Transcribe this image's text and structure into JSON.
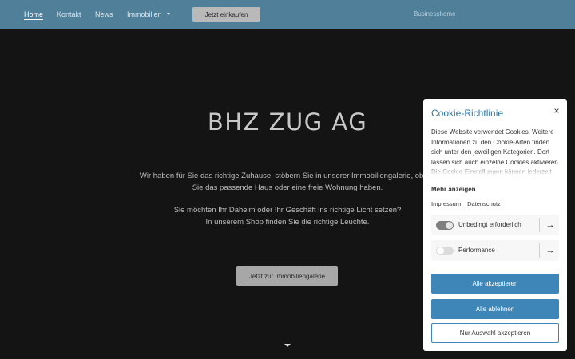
{
  "nav": {
    "items": [
      {
        "label": "Home",
        "active": true
      },
      {
        "label": "Kontakt"
      },
      {
        "label": "News"
      },
      {
        "label": "Immobilien",
        "has_dropdown": true
      }
    ],
    "shop_button": "Jetzt einkaufen",
    "brand": "Businesshome",
    "bg_color": "#4f7f99"
  },
  "hero": {
    "title": "BHZ  ZUG AG",
    "paragraph1_line1": "Wir haben für Sie das richtige Zuhause, stöbern Sie in unserer Immobiliengalerie, ob wir",
    "paragraph1_line2": "Sie das passende Haus oder eine freie Wohnung haben.",
    "paragraph2_line1": "Sie möchten Ihr Daheim oder Ihr Geschäft ins richtige Licht setzen?",
    "paragraph2_line2": "In unserem Shop finden Sie die richtige Leuchte.",
    "cta": "Jetzt zur Immobiliengalerie",
    "scroll_icon": "chevron-down-icon"
  },
  "cookie": {
    "title": "Cookie-Richtlinie",
    "close_icon": "close-icon",
    "close_symbol": "×",
    "description": "Diese Website verwendet Cookies. Weitere Informationen zu den Cookie-Arten finden sich unter den jeweiligen Kategorien. Dort lassen sich auch einzelne Cookies aktivieren. Die Cookie-Einstellungen können jederzeit",
    "more": "Mehr anzeigen",
    "links": [
      "Impressum",
      "Datenschutz"
    ],
    "categories": [
      {
        "label": "Unbedingt erforderlich",
        "enabled": true,
        "arrow": "→"
      },
      {
        "label": "Performance",
        "enabled": false,
        "arrow": "→"
      }
    ],
    "buttons": {
      "accept_all": "Alle akzeptieren",
      "reject_all": "Alle ablehnen",
      "accept_selection": "Nur Auswahl akzeptieren"
    },
    "accent_color": "#3e86b8"
  }
}
